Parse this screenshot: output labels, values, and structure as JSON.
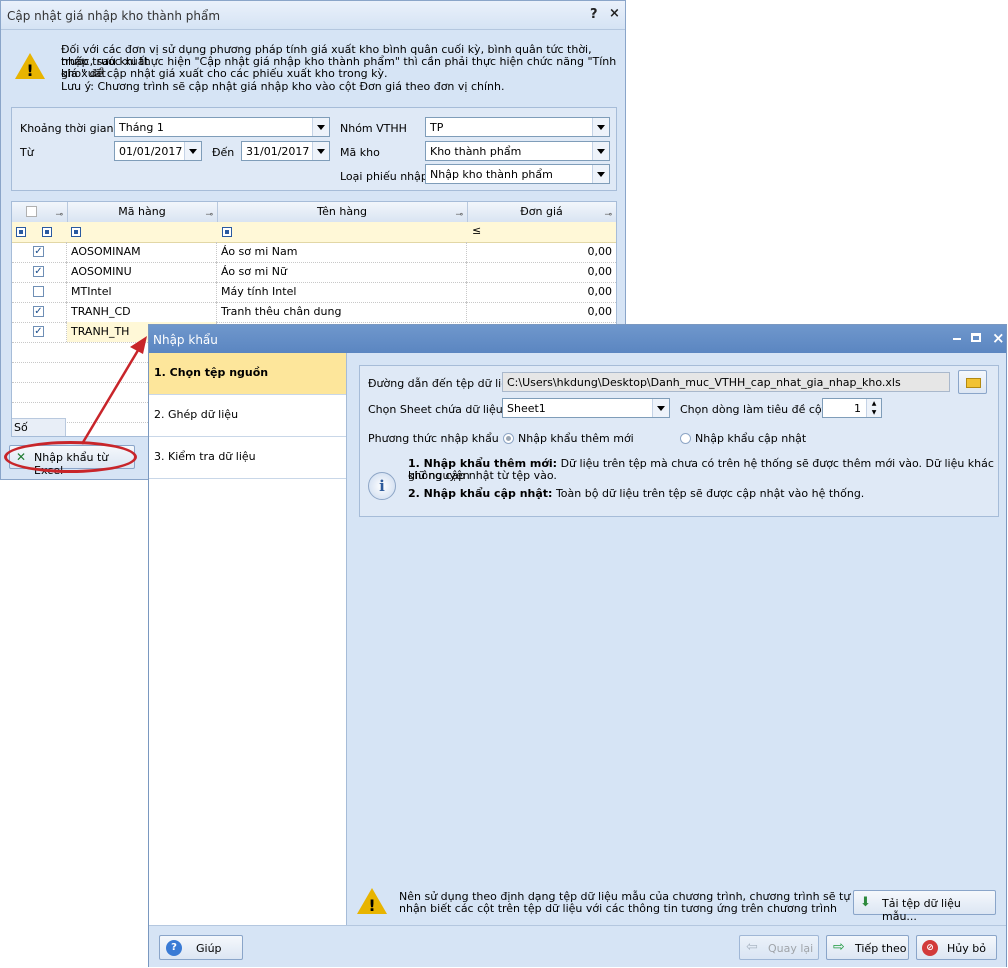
{
  "back_window": {
    "title": "Cập nhật giá nhập kho thành phẩm",
    "help_btn": "?",
    "close_btn": "×",
    "notice_line1": "Đối với các đơn vị sử dụng phương pháp tính giá xuất kho bình quân cuối kỳ, bình quân tức thời, nhập trước xuất",
    "notice_line2": "trước, sau khi thực hiện \"Cập nhật giá nhập kho thành phẩm\" thì cần phải thực hiện chức năng \"Tính giá xuất",
    "notice_line3": "kho\" để cập nhật giá xuất cho các phiếu xuất kho trong kỳ.",
    "notice_line4": "Lưu ý: Chương trình sẽ cập nhật giá nhập kho vào cột Đơn giá theo đơn vị chính.",
    "filters": {
      "period_label": "Khoảng thời gian",
      "period_value": "Tháng 1",
      "from_label": "Từ",
      "from_value": "01/01/2017",
      "to_label": "Đến",
      "to_value": "31/01/2017",
      "group_label": "Nhóm VTHH",
      "group_value": "TP",
      "warehouse_label": "Mã kho",
      "warehouse_value": "Kho thành phẩm",
      "type_label": "Loại phiếu nhập",
      "type_value": "Nhập kho thành phẩm"
    },
    "grid": {
      "columns": [
        "Mã hàng",
        "Tên hàng",
        "Đơn giá"
      ],
      "filter_price_op": "≤",
      "rows": [
        {
          "code": "AOSOMINAM",
          "name": "Áo sơ mi Nam",
          "price": "0,00",
          "checked": "✓"
        },
        {
          "code": "AOSOMINU",
          "name": "Áo sơ mi Nữ",
          "price": "0,00",
          "checked": "✓"
        },
        {
          "code": "MTIntel",
          "name": "Máy tính Intel",
          "price": "0,00",
          "checked": ""
        },
        {
          "code": "TRANH_CD",
          "name": "Tranh thêu chân dung",
          "price": "0,00",
          "checked": "✓"
        },
        {
          "code": "TRANH_TH",
          "name": "",
          "price": "",
          "checked": "✓"
        }
      ],
      "footer_label": "Số dòng..."
    },
    "import_excel_btn": "Nhập khẩu từ Excel"
  },
  "front_window": {
    "title": "Nhập khẩu",
    "steps": [
      "1. Chọn tệp nguồn",
      "2. Ghép dữ liệu",
      "3. Kiểm tra dữ liệu"
    ],
    "path_label": "Đường dẫn đến tệp dữ liệu",
    "path_value": "C:\\Users\\hkdung\\Desktop\\Danh_muc_VTHH_cap_nhat_gia_nhap_kho.xls",
    "sheet_label": "Chọn Sheet chứa dữ liệu",
    "sheet_value": "Sheet1",
    "header_row_label": "Chọn dòng làm tiêu đề cột",
    "header_row_value": "1",
    "method_label": "Phương thức nhập khẩu",
    "method_new": "Nhập khẩu thêm mới",
    "method_update": "Nhập khẩu cập nhật",
    "info1_title": "1. Nhập khẩu thêm mới:",
    "info1_text": " Dữ liệu trên tệp mà chưa có trên hệ thống sẽ được thêm mới vào. Dữ liệu khác giữ nguyên",
    "info1_text2": "không cập nhật từ tệp vào.",
    "info2_title": "2. Nhập khẩu cập nhật:",
    "info2_text": " Toàn bộ dữ liệu trên tệp sẽ được cập nhật vào hệ thống.",
    "tip_line1": "Nên sử dụng theo định dạng tệp dữ liệu mẫu của chương trình, chương trình sẽ tự động",
    "tip_line2": "nhận biết các cột trên tệp dữ liệu với các thông tin tương ứng trên chương trình",
    "download_btn": "Tải tệp dữ liệu mẫu...",
    "help_btn": "Giúp",
    "back_btn": "Quay lại",
    "next_btn": "Tiếp theo",
    "cancel_btn": "Hủy bỏ",
    "close_x": "×"
  },
  "colors": {
    "annotation_red": "#c8252a",
    "selected_step": "#fde69b",
    "window_bg": "#d6e4f5",
    "title_blue": "#5b86c1"
  }
}
